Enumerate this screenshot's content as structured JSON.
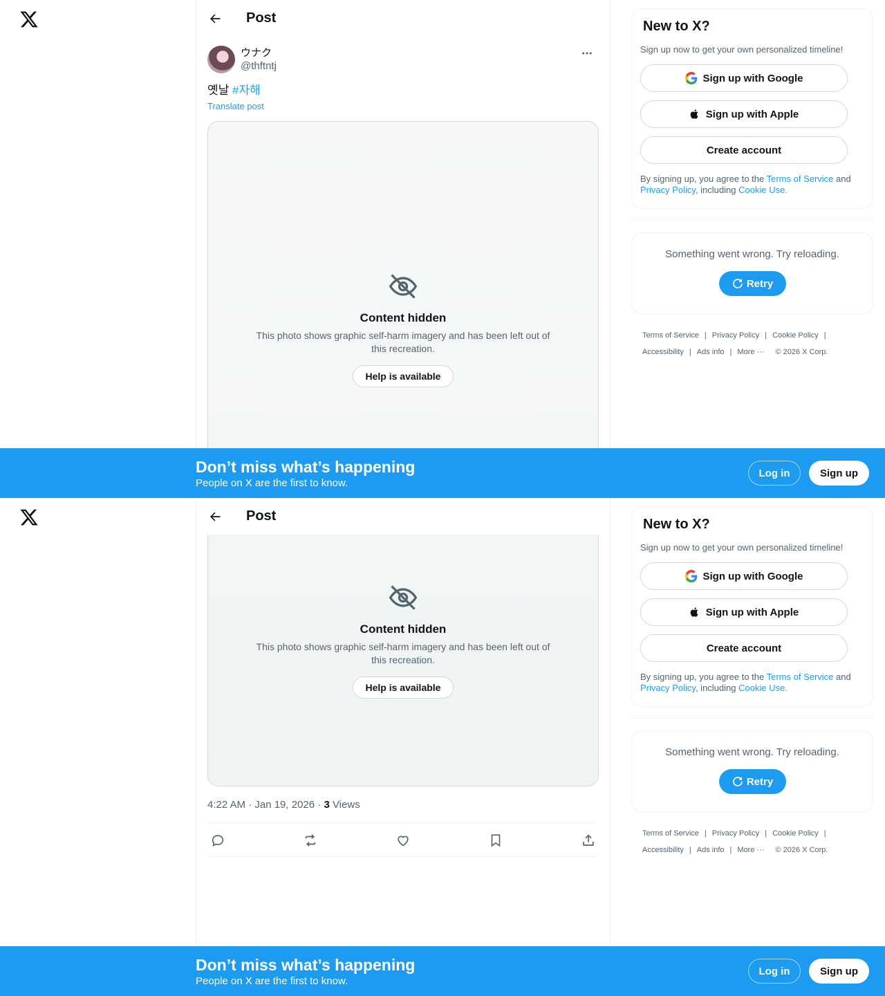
{
  "header": {
    "title": "Post"
  },
  "post": {
    "display_name": "ウナク",
    "handle": "@thftntj",
    "text": "옛날 ",
    "hashtag": "#자해",
    "translate_label": "Translate post",
    "media_placeholder": {
      "title": "Content hidden",
      "description": "This photo shows graphic self-harm imagery and has been left out of this recreation.",
      "button": "Help is available"
    },
    "time": "4:22 AM · Jan 19, 2026 · ",
    "views_count": "3",
    "views_label": " Views"
  },
  "signup_card": {
    "title": "New to X?",
    "subtitle": "Sign up now to get your own personalized timeline!",
    "google_label": "Sign up with Google",
    "apple_label": "Sign up with Apple",
    "create_label": "Create account",
    "legal_prefix": "By signing up, you agree to the ",
    "terms_link": "Terms of Service",
    "legal_and": " and ",
    "privacy_link": "Privacy Policy",
    "legal_including": ", including ",
    "cookie_link": "Cookie Use."
  },
  "error_card": {
    "message": "Something went wrong. Try reloading.",
    "retry_label": "Retry"
  },
  "footer": {
    "terms": "Terms of Service",
    "privacy": "Privacy Policy",
    "cookie": "Cookie Policy",
    "accessibility": "Accessibility",
    "ads": "Ads info",
    "more": "More ···",
    "copyright": "© 2026 X Corp.",
    "separator": "|"
  },
  "banner": {
    "title": "Don’t miss what’s happening",
    "subtitle": "People on X are the first to know.",
    "login_label": "Log in",
    "signup_label": "Sign up"
  },
  "colors": {
    "accent": "#1d9bf0",
    "text": "#0f1419",
    "muted": "#536471",
    "border": "#eff3f4"
  },
  "icons": [
    "x-logo-icon",
    "back-arrow-icon",
    "more-icon",
    "eye-slash-icon",
    "reply-icon",
    "repost-icon",
    "like-icon",
    "bookmark-icon",
    "share-icon",
    "google-icon",
    "apple-icon",
    "retry-icon"
  ]
}
